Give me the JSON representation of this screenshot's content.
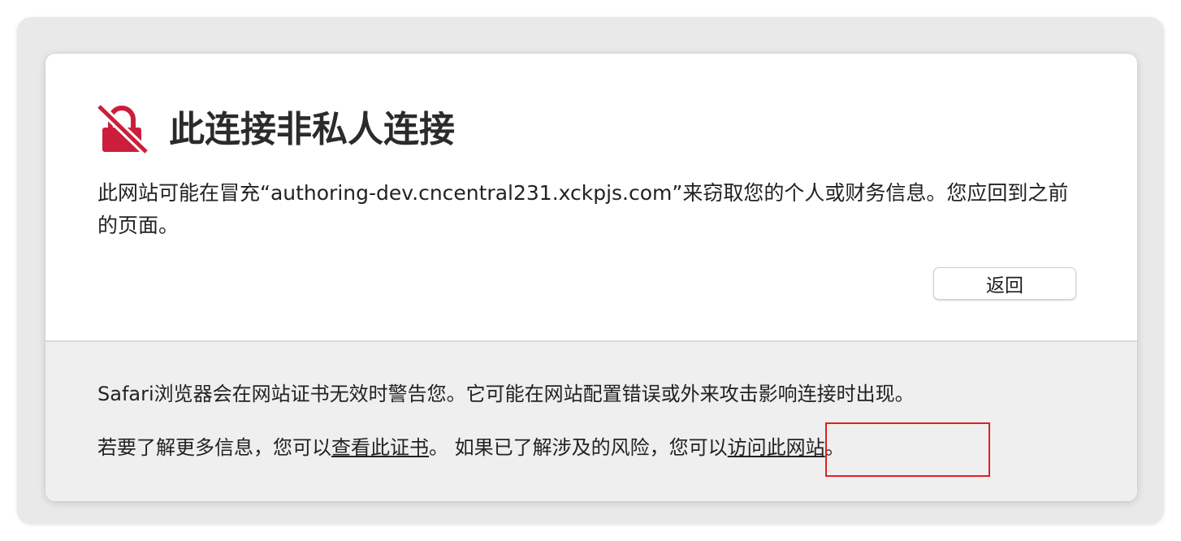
{
  "colors": {
    "accent": "#cc1e3c",
    "annotation": "#e02020",
    "card_background": "#ffffff",
    "footer_background": "#efefef"
  },
  "header": {
    "icon": "lock-slash-icon",
    "title": "此连接非私人连接"
  },
  "warning": {
    "text": "此网站可能在冒充“authoring-dev.cncentral231.xckpjs.com”来窃取您的个人或财务信息。您应回到之前的页面。"
  },
  "actions": {
    "back_label": "返回"
  },
  "details": {
    "info_text": "Safari浏览器会在网站证书无效时警告您。它可能在网站配置错误或外来攻击影响连接时出现。",
    "more_prefix": "若要了解更多信息，您可以",
    "view_certificate_link": "查看此证书",
    "more_middle": "。 如果已了解涉及的风险，您可",
    "visit_prefix": "以",
    "visit_site_link": "访问此网站",
    "more_suffix": "。"
  }
}
